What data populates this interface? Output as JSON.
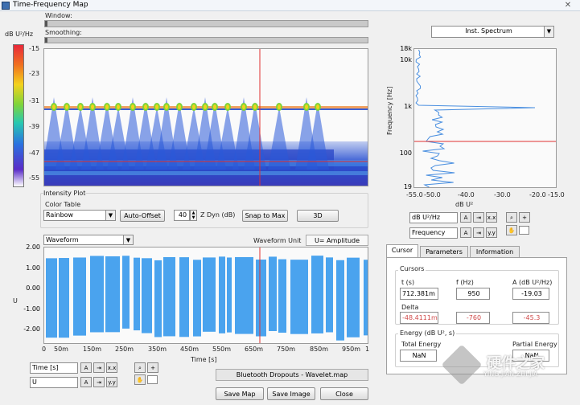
{
  "window": {
    "title": "Time-Frequency Map"
  },
  "sliders": {
    "window_label": "Window:",
    "smoothing_label": "Smoothing:"
  },
  "colorbar": {
    "unit": "dB U²/Hz",
    "ticks": [
      "-15",
      "-23",
      "-31",
      "-39",
      "-47",
      "-55"
    ]
  },
  "intensity": {
    "group_label": "Intensity Plot",
    "color_table_label": "Color Table",
    "color_table_value": "Rainbow",
    "auto_offset": "Auto-Offset",
    "zdyn_value": "40",
    "zdyn_label": "Z Dyn (dB)",
    "snap_to_max": "Snap to Max",
    "three_d": "3D"
  },
  "waveform": {
    "selector_value": "Waveform",
    "unit_label": "Waveform Unit",
    "unit_value": "U= Amplitude",
    "y_axis_label": "U",
    "y_ticks": [
      "2.00",
      "1.00",
      "0.00",
      "-1.00",
      "-2.00"
    ],
    "x_ticks": [
      "0",
      "50m",
      "150m",
      "250m",
      "350m",
      "450m",
      "550m",
      "650m",
      "750m",
      "850m",
      "950m",
      "1"
    ],
    "x_axis_label": "Time [s]",
    "x_scale_name": "Time [s]",
    "y_scale_name": "U"
  },
  "spectrum": {
    "selector_value": "Inst. Spectrum",
    "y_axis_label": "Frequency [Hz]",
    "y_ticks": [
      "18k",
      "10k",
      "1k",
      "100",
      "19"
    ],
    "x_axis_label": "dB U²",
    "x_ticks": [
      "-55.0",
      "-50.0",
      "-40.0",
      "-30.0",
      "-20.0",
      "-15.0"
    ],
    "x_scale_name": "dB U²/Hz",
    "y_scale_name": "Frequency"
  },
  "tabs": [
    "Cursor",
    "Parameters",
    "Information"
  ],
  "cursor": {
    "group_label": "Cursors",
    "t_label": "t (s)",
    "f_label": "f (Hz)",
    "a_label": "A (dB U²/Hz)",
    "t_value": "712.381m",
    "f_value": "950",
    "a_value": "-19.03",
    "delta_label": "Delta",
    "dt_value": "-48.4111m",
    "df_value": "-760",
    "da_value": "-45.3"
  },
  "energy": {
    "group_label": "Energy (dB U², s)",
    "total_label": "Total Energy",
    "total_value": "NaN",
    "partial_label": "Partial Energy",
    "partial_value": "NaN"
  },
  "file_label": "Bluetooth Dropouts - Wavelet.map",
  "buttons": {
    "save_map": "Save Map",
    "save_image": "Save Image",
    "close": "Close"
  },
  "watermark": {
    "line1": "硬件之家",
    "line2": "YING JIAN ZHI JIA"
  },
  "colors": {
    "accent_wave": "#4aa3ee",
    "cursor_line": "#e03030",
    "spectrum_line": "#4a8fe0"
  }
}
